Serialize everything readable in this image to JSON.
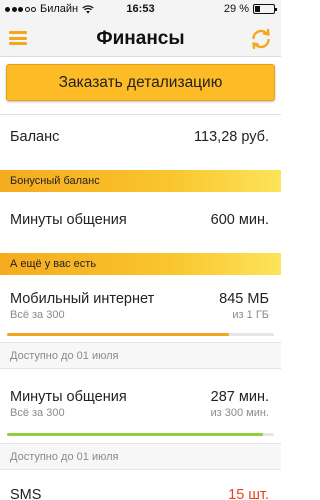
{
  "status_bar": {
    "carrier": "Билайн",
    "time": "16:53",
    "battery": "29 %"
  },
  "header": {
    "title": "Финансы",
    "menu_icon": "hamburger-icon",
    "refresh_icon": "refresh-icon"
  },
  "order_button": {
    "label": "Заказать детализацию"
  },
  "balance": {
    "label": "Баланс",
    "value": "113,28 руб."
  },
  "bonus_section": {
    "title": "Бонусный баланс",
    "items": [
      {
        "label": "Минуты общения",
        "value": "600 мин."
      }
    ]
  },
  "extras_section": {
    "title": "А ещё у вас есть",
    "items": [
      {
        "label": "Мобильный интернет",
        "value": "845 МБ",
        "sub_left": "Всё за 300",
        "sub_right": "из 1 ГБ",
        "progress": 0.83,
        "bar_color": "#f4a21c",
        "available": "Доступно до 01 июля"
      },
      {
        "label": "Минуты общения",
        "value": "287 мин.",
        "sub_left": "Всё за 300",
        "sub_right": "из 300 мин.",
        "progress": 0.96,
        "bar_color": "#8fcf3c",
        "available": "Доступно до 01 июля"
      },
      {
        "label": "SMS",
        "value": "15 шт.",
        "value_color": "#e8431e"
      }
    ]
  },
  "colors": {
    "accent": "#fdbb26",
    "icon_yellow": "#f3a81b"
  }
}
